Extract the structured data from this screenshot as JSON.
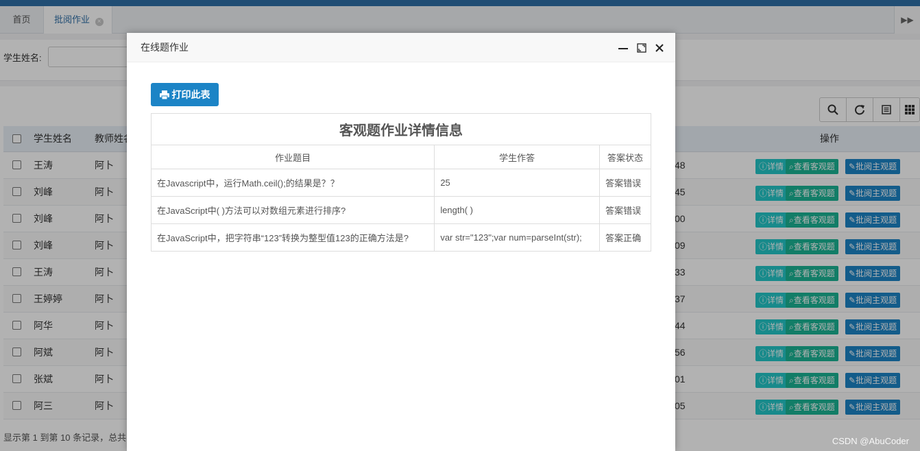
{
  "tabs": {
    "home": "首页",
    "active": "批阅作业"
  },
  "search": {
    "label": "学生姓名:"
  },
  "table": {
    "headers": {
      "student": "学生姓名",
      "teacher": "教师姓名",
      "ops": "操作"
    },
    "rows": [
      {
        "student": "王涛",
        "teacher": "阿卜",
        "tail": "48"
      },
      {
        "student": "刘峰",
        "teacher": "阿卜",
        "tail": "45"
      },
      {
        "student": "刘峰",
        "teacher": "阿卜",
        "tail": "00"
      },
      {
        "student": "刘峰",
        "teacher": "阿卜",
        "tail": "09"
      },
      {
        "student": "王涛",
        "teacher": "阿卜",
        "tail": "33"
      },
      {
        "student": "王婷婷",
        "teacher": "阿卜",
        "tail": "37"
      },
      {
        "student": "阿华",
        "teacher": "阿卜",
        "tail": "44"
      },
      {
        "student": "阿斌",
        "teacher": "阿卜",
        "tail": "56"
      },
      {
        "student": "张斌",
        "teacher": "阿卜",
        "tail": "01"
      },
      {
        "student": "阿三",
        "teacher": "阿卜",
        "tail": "05"
      }
    ],
    "actions": {
      "detail": "详情",
      "view_objective": "查看客观题",
      "review_subjective": "批阅主观题"
    }
  },
  "footer": {
    "summary": "显示第 1 到第 10 条记录，总共"
  },
  "modal": {
    "title": "在线题作业",
    "print_label": "打印此表",
    "caption": "客观题作业详情信息",
    "columns": {
      "question": "作业题目",
      "answer": "学生作答",
      "status": "答案状态"
    },
    "rows": [
      {
        "question": "在Javascript中，运行Math.ceil();的结果是？？",
        "answer": "25",
        "status": "答案错误",
        "correct": false
      },
      {
        "question": "在JavaScript中( )方法可以对数组元素进行排序?",
        "answer": "length( )",
        "status": "答案错误",
        "correct": false
      },
      {
        "question": "在JavaScript中，把字符串“123”转换为整型值123的正确方法是?",
        "answer": "var str=\"123\";var num=parseInt(str);",
        "status": "答案正确",
        "correct": true
      }
    ]
  },
  "watermark": "CSDN @AbuCoder",
  "colors": {
    "primary": "#1c84c6",
    "success": "#1ab394",
    "info": "#23c6c8",
    "danger": "#e02020"
  }
}
